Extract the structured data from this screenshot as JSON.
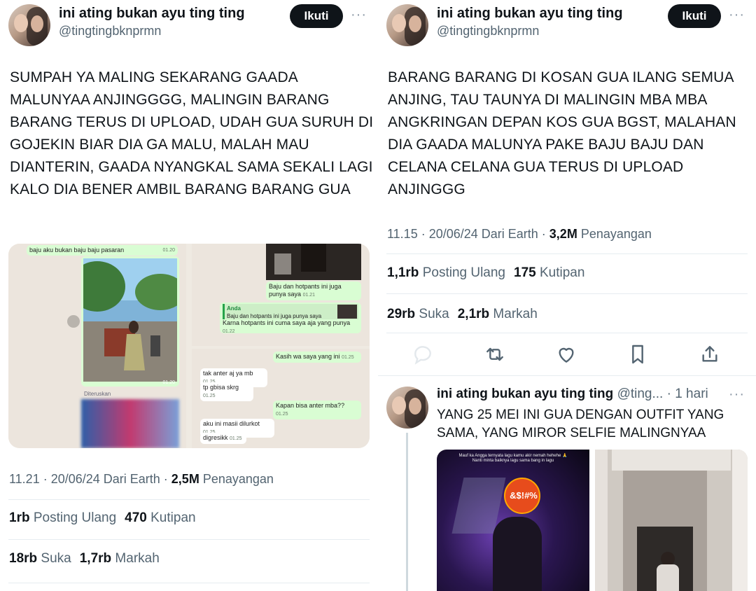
{
  "colors": {
    "text": "#0f1419",
    "secondary": "#536471",
    "divider": "#e6ecf0",
    "chat_out": "#d9fdd3",
    "chat_bg": "#ece5dd"
  },
  "left_tweet": {
    "author_name": "ini ating bukan ayu ting ting",
    "handle": "@tingtingbknprmn",
    "follow_label": "Ikuti",
    "more": "···",
    "text": "SUMPAH YA MALING SEKARANG GAADA MALUNYAA ANJINGGGG, MALINGIN BARANG BARANG TERUS DI UPLOAD, UDAH GUA SURUH DI GOJEKIN BIAR DIA GA MALU, MALAH MAU DIANTERIN, GAADA NYANGKAL SAMA SEKALI LAGI KALO DIA BENER AMBIL BARANG BARANG GUA",
    "chat": {
      "top_bubble": "baju aku bukan baju baju pasaran",
      "top_time": "01.20",
      "photo_time": "01.20",
      "forwarded": "Diteruskan",
      "r1": "Baju dan hotpants ini juga punya saya",
      "r1_time": "01.21",
      "reply_from": "Anda",
      "reply_quote": "Baju dan hotpants ini juga punya saya",
      "r2": "Karna hotpants ini cuma saya aja yang punya",
      "r2_time": "01.22",
      "r3": "Kasih wa saya yang ini",
      "r3_time": "01.25",
      "i1": "tak anter aj ya mb",
      "i1_time": "01.25",
      "i2": "tp gbisa skrg",
      "i2_time": "01.25",
      "r4": "Kapan bisa anter mba??",
      "r4_time": "01.25",
      "i3": "aku ini masii dilurkot",
      "i3_time": "01.25",
      "i4": "digresikk",
      "i4_time": "01.25"
    },
    "time": "11.21 · 20/06/24 Dari Earth · ",
    "views_count": "2,5M",
    "views_label": " Penayangan",
    "reposts_count": "1rb",
    "reposts_label": " Posting Ulang",
    "quotes_count": "470",
    "quotes_label": " Kutipan",
    "likes_count": "18rb",
    "likes_label": " Suka",
    "bookmarks_count": "1,7rb",
    "bookmarks_label": " Markah"
  },
  "right_tweet": {
    "author_name": "ini ating bukan ayu ting ting",
    "handle": "@tingtingbknprmn",
    "follow_label": "Ikuti",
    "more": "···",
    "text": "BARANG BARANG DI KOSAN GUA ILANG SEMUA ANJING, TAU TAUNYA DI MALINGIN MBA MBA ANGKRINGAN DEPAN KOS GUA BGST, MALAHAN DIA GAADA MALUNYA PAKE BAJU BAJU DAN CELANA CELANA GUA TERUS DI UPLOAD ANJINGGG",
    "time": "11.15 · 20/06/24 Dari Earth · ",
    "views_count": "3,2M",
    "views_label": " Penayangan",
    "reposts_count": "1,1rb",
    "reposts_label": " Posting Ulang",
    "quotes_count": "175",
    "quotes_label": " Kutipan",
    "likes_count": "29rb",
    "likes_label": " Suka",
    "bookmarks_count": "2,1rb",
    "bookmarks_label": " Markah",
    "actions": [
      "reply-icon",
      "repost-icon",
      "like-icon",
      "bookmark-icon",
      "share-icon"
    ]
  },
  "reply_tweet": {
    "author_name": "ini ating bukan ayu ting ting",
    "handle_trunc": "@ting...",
    "age": " · 1 hari",
    "more": "···",
    "text": "YANG 25 MEI INI GUA DENGAN OUTFIT YANG SAMA, YANG MIROR SELFIE MALINGNYAA",
    "story_caption": "Mauf ka Angga ternyata lagu kamu akir nemah hehehe 🙏 Nanti minta baiknya lagu sama bang in lagu",
    "sticker_text": "&$!#%"
  }
}
